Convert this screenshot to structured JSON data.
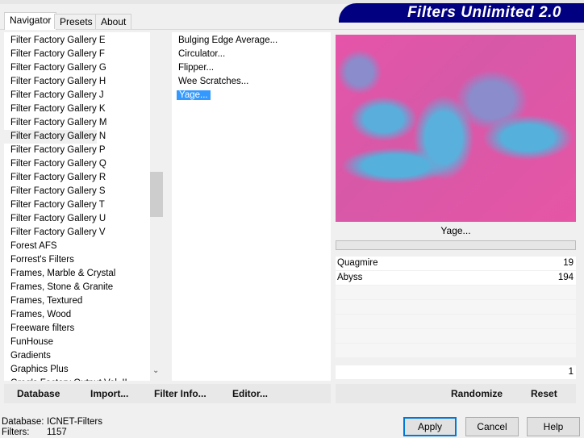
{
  "header": {
    "title": "Filters Unlimited 2.0"
  },
  "tabs": [
    {
      "label": "Navigator"
    },
    {
      "label": "Presets"
    },
    {
      "label": "About"
    }
  ],
  "categories": [
    "Filter Factory Gallery E",
    "Filter Factory Gallery F",
    "Filter Factory Gallery G",
    "Filter Factory Gallery H",
    "Filter Factory Gallery J",
    "Filter Factory Gallery K",
    "Filter Factory Gallery M",
    "Filter Factory Gallery N",
    "Filter Factory Gallery P",
    "Filter Factory Gallery Q",
    "Filter Factory Gallery R",
    "Filter Factory Gallery S",
    "Filter Factory Gallery T",
    "Filter Factory Gallery U",
    "Filter Factory Gallery V",
    "Forest AFS",
    "Forrest's Filters",
    "Frames, Marble & Crystal",
    "Frames, Stone & Granite",
    "Frames, Textured",
    "Frames, Wood",
    "Freeware filters",
    "FunHouse",
    "Gradients",
    "Graphics Plus",
    "Greg's Factory Output Vol. II"
  ],
  "selected_category": "Filter Factory Gallery N",
  "category_scroll_fraction": 0.4,
  "filters": [
    "Bulging Edge Average...",
    "Circulator...",
    "Flipper...",
    "Wee Scratches...",
    "Yage..."
  ],
  "selected_filter": "Yage...",
  "preview": {
    "label": "Yage...",
    "colors": [
      "#e655a6",
      "#55b0dc",
      "#8a8ccc"
    ]
  },
  "params": [
    {
      "name": "Quagmire",
      "value": "19"
    },
    {
      "name": "Abyss",
      "value": "194"
    }
  ],
  "param_bottom_value": "1",
  "buttons": {
    "database": "Database",
    "import": "Import...",
    "filter_info": "Filter Info...",
    "editor": "Editor...",
    "randomize": "Randomize",
    "reset": "Reset",
    "apply": "Apply",
    "cancel": "Cancel",
    "help": "Help"
  },
  "status": {
    "database_label": "Database:",
    "database_value": "ICNET-Filters",
    "filters_label": "Filters:",
    "filters_value": "1157"
  }
}
